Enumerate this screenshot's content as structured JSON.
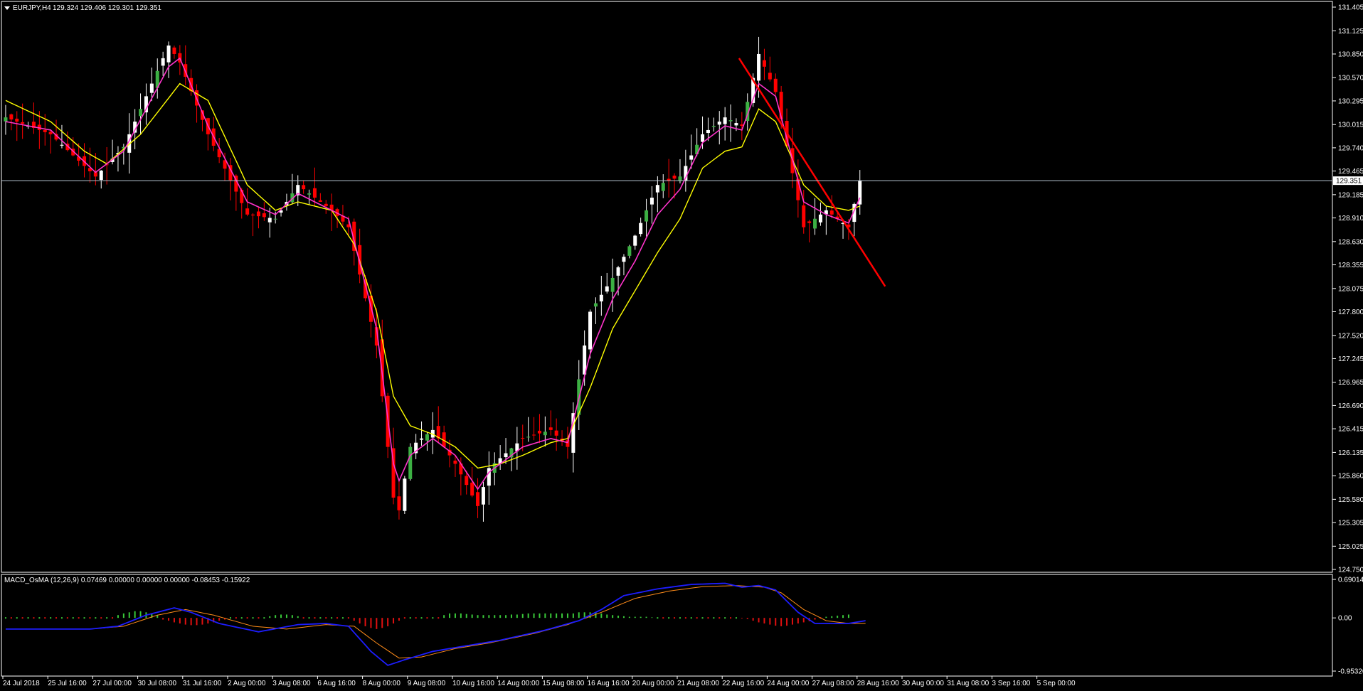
{
  "header": {
    "symbol": "EURJPY,H4",
    "ohlc": "129.324 129.406 129.301 129.351"
  },
  "indicator": {
    "title": "MACD_OsMA (12,26,9) 0.07469 0.00000 0.00000 0.00000 -0.08453 -0.15922"
  },
  "colors": {
    "background": "#000000",
    "frame": "#ffffff",
    "bull_candle": "#ffffff",
    "bull_candle_alt": "#3cb043",
    "bear_candle": "#ff0000",
    "ma_fast": "#ff33cc",
    "ma_slow": "#ffff00",
    "trendline": "#ff0000",
    "price_line": "#b7c3d0",
    "macd_main": "#1d1dff",
    "macd_signal": "#ff8c1a",
    "osma_pos": "#39c839",
    "osma_neg": "#e01010"
  },
  "chart_data": [
    {
      "type": "candlestick",
      "symbol": "EURJPY",
      "timeframe": "H4",
      "y_ticks": [
        "131.405",
        "131.125",
        "130.850",
        "130.570",
        "130.295",
        "130.015",
        "129.740",
        "129.465",
        "129.185",
        "128.910",
        "128.630",
        "128.355",
        "128.075",
        "127.800",
        "127.520",
        "127.245",
        "126.965",
        "126.690",
        "126.415",
        "126.135",
        "125.860",
        "125.580",
        "125.305",
        "125.025",
        "124.750"
      ],
      "ylim": [
        124.75,
        131.405
      ],
      "current_price": "129.351",
      "x_ticks": [
        "24 Jul 2018",
        "25 Jul 16:00",
        "27 Jul 00:00",
        "30 Jul 08:00",
        "31 Jul 16:00",
        "2 Aug 00:00",
        "3 Aug 08:00",
        "6 Aug 16:00",
        "8 Aug 00:00",
        "9 Aug 08:00",
        "10 Aug 16:00",
        "14 Aug 00:00",
        "15 Aug 08:00",
        "16 Aug 16:00",
        "20 Aug 00:00",
        "21 Aug 08:00",
        "22 Aug 16:00",
        "24 Aug 00:00",
        "27 Aug 08:00",
        "28 Aug 16:00",
        "30 Aug 00:00",
        "31 Aug 08:00",
        "3 Sep 16:00",
        "5 Sep 00:00"
      ],
      "price_path": [
        [
          0,
          130.1
        ],
        [
          8,
          129.9
        ],
        [
          16,
          129.4
        ],
        [
          21,
          129.75
        ],
        [
          29,
          130.95
        ],
        [
          31,
          130.75
        ],
        [
          36,
          129.9
        ],
        [
          43,
          128.95
        ],
        [
          48,
          128.9
        ],
        [
          52,
          129.3
        ],
        [
          58,
          129.0
        ],
        [
          61,
          128.8
        ],
        [
          66,
          127.4
        ],
        [
          69,
          125.6
        ],
        [
          70,
          125.45
        ],
        [
          72,
          126.2
        ],
        [
          76,
          126.4
        ],
        [
          80,
          126.0
        ],
        [
          84,
          125.5
        ],
        [
          86,
          125.95
        ],
        [
          92,
          126.3
        ],
        [
          97,
          126.4
        ],
        [
          100,
          126.2
        ],
        [
          104,
          127.8
        ],
        [
          108,
          128.2
        ],
        [
          112,
          128.7
        ],
        [
          116,
          129.3
        ],
        [
          120,
          129.4
        ],
        [
          124,
          129.9
        ],
        [
          128,
          130.1
        ],
        [
          131,
          130.0
        ],
        [
          134,
          130.85
        ],
        [
          137,
          130.4
        ],
        [
          142,
          128.8
        ],
        [
          146,
          129.0
        ],
        [
          150,
          128.8
        ],
        [
          152,
          129.35
        ]
      ],
      "ma_fast_path": [
        [
          0,
          130.05
        ],
        [
          8,
          129.95
        ],
        [
          16,
          129.45
        ],
        [
          21,
          129.7
        ],
        [
          29,
          130.7
        ],
        [
          31,
          130.8
        ],
        [
          36,
          130.0
        ],
        [
          43,
          129.1
        ],
        [
          48,
          128.95
        ],
        [
          52,
          129.2
        ],
        [
          58,
          129.0
        ],
        [
          61,
          128.9
        ],
        [
          66,
          127.6
        ],
        [
          69,
          126.0
        ],
        [
          70,
          125.8
        ],
        [
          72,
          126.1
        ],
        [
          76,
          126.3
        ],
        [
          80,
          126.1
        ],
        [
          84,
          125.7
        ],
        [
          86,
          125.9
        ],
        [
          92,
          126.2
        ],
        [
          97,
          126.3
        ],
        [
          100,
          126.25
        ],
        [
          104,
          127.3
        ],
        [
          108,
          127.95
        ],
        [
          112,
          128.4
        ],
        [
          116,
          128.95
        ],
        [
          120,
          129.25
        ],
        [
          124,
          129.8
        ],
        [
          128,
          130.0
        ],
        [
          131,
          129.95
        ],
        [
          134,
          130.5
        ],
        [
          137,
          130.35
        ],
        [
          142,
          129.1
        ],
        [
          146,
          128.95
        ],
        [
          150,
          128.85
        ],
        [
          152,
          129.15
        ]
      ],
      "ma_slow_path": [
        [
          0,
          130.3
        ],
        [
          8,
          130.05
        ],
        [
          14,
          129.7
        ],
        [
          18,
          129.55
        ],
        [
          24,
          129.9
        ],
        [
          31,
          130.5
        ],
        [
          36,
          130.3
        ],
        [
          43,
          129.3
        ],
        [
          48,
          129.0
        ],
        [
          52,
          129.1
        ],
        [
          58,
          129.0
        ],
        [
          62,
          128.6
        ],
        [
          66,
          127.8
        ],
        [
          69,
          126.8
        ],
        [
          72,
          126.45
        ],
        [
          76,
          126.35
        ],
        [
          80,
          126.2
        ],
        [
          84,
          125.95
        ],
        [
          88,
          126.0
        ],
        [
          92,
          126.1
        ],
        [
          97,
          126.25
        ],
        [
          100,
          126.3
        ],
        [
          104,
          126.9
        ],
        [
          108,
          127.6
        ],
        [
          112,
          128.05
        ],
        [
          116,
          128.5
        ],
        [
          120,
          128.9
        ],
        [
          124,
          129.5
        ],
        [
          128,
          129.7
        ],
        [
          131,
          129.75
        ],
        [
          134,
          130.2
        ],
        [
          137,
          130.05
        ],
        [
          142,
          129.3
        ],
        [
          146,
          129.05
        ],
        [
          150,
          129.0
        ],
        [
          152,
          129.05
        ]
      ],
      "trendline": [
        [
          131,
          130.8
        ],
        [
          157,
          128.1
        ]
      ]
    },
    {
      "type": "macd_osma",
      "y_ticks": [
        "0.69014",
        "0.00",
        "-0.95326"
      ],
      "ylim": [
        -0.95326,
        0.69014
      ],
      "macd_path": [
        [
          0,
          -0.2
        ],
        [
          15,
          -0.2
        ],
        [
          20,
          -0.15
        ],
        [
          25,
          0.05
        ],
        [
          30,
          0.18
        ],
        [
          33,
          0.1
        ],
        [
          38,
          -0.1
        ],
        [
          45,
          -0.25
        ],
        [
          52,
          -0.12
        ],
        [
          57,
          -0.1
        ],
        [
          61,
          -0.15
        ],
        [
          65,
          -0.6
        ],
        [
          68,
          -0.85
        ],
        [
          71,
          -0.75
        ],
        [
          76,
          -0.6
        ],
        [
          82,
          -0.5
        ],
        [
          88,
          -0.4
        ],
        [
          96,
          -0.22
        ],
        [
          102,
          -0.05
        ],
        [
          106,
          0.15
        ],
        [
          110,
          0.4
        ],
        [
          116,
          0.52
        ],
        [
          122,
          0.6
        ],
        [
          128,
          0.62
        ],
        [
          131,
          0.55
        ],
        [
          134,
          0.58
        ],
        [
          137,
          0.5
        ],
        [
          141,
          0.1
        ],
        [
          144,
          -0.1
        ],
        [
          150,
          -0.1
        ],
        [
          153,
          -0.05
        ]
      ],
      "signal_path": [
        [
          0,
          -0.2
        ],
        [
          15,
          -0.2
        ],
        [
          21,
          -0.15
        ],
        [
          27,
          0.05
        ],
        [
          32,
          0.15
        ],
        [
          37,
          0.05
        ],
        [
          44,
          -0.15
        ],
        [
          50,
          -0.2
        ],
        [
          57,
          -0.12
        ],
        [
          62,
          -0.15
        ],
        [
          66,
          -0.45
        ],
        [
          70,
          -0.72
        ],
        [
          74,
          -0.7
        ],
        [
          80,
          -0.55
        ],
        [
          86,
          -0.45
        ],
        [
          94,
          -0.28
        ],
        [
          100,
          -0.12
        ],
        [
          106,
          0.1
        ],
        [
          112,
          0.35
        ],
        [
          118,
          0.48
        ],
        [
          124,
          0.56
        ],
        [
          130,
          0.58
        ],
        [
          135,
          0.55
        ],
        [
          138,
          0.45
        ],
        [
          142,
          0.15
        ],
        [
          146,
          -0.05
        ],
        [
          150,
          -0.1
        ],
        [
          153,
          -0.1
        ]
      ],
      "osma_values": [
        0,
        0,
        0,
        0,
        0,
        0,
        0,
        0,
        0,
        0,
        0,
        0,
        0,
        0,
        0,
        0,
        0,
        0,
        0,
        0,
        0.05,
        0.08,
        0.1,
        0.12,
        0.12,
        0.1,
        0.08,
        0.05,
        -0.03,
        -0.05,
        -0.08,
        -0.1,
        -0.12,
        -0.13,
        -0.13,
        -0.12,
        -0.1,
        -0.08,
        -0.05,
        -0.03,
        0,
        0,
        0,
        0,
        0,
        0,
        0,
        0.03,
        0.05,
        0.06,
        0.06,
        0.05,
        0.03,
        0,
        0,
        0,
        0,
        0,
        0,
        0,
        0,
        0,
        -0.05,
        -0.1,
        -0.15,
        -0.18,
        -0.2,
        -0.18,
        -0.15,
        -0.1,
        -0.05,
        0,
        0,
        0,
        0,
        0,
        0,
        0,
        0.05,
        0.08,
        0.08,
        0.08,
        0.07,
        0.06,
        0.05,
        0.05,
        0.05,
        0.05,
        0.05,
        0.05,
        0.06,
        0.06,
        0.07,
        0.08,
        0.08,
        0.08,
        0.08,
        0.08,
        0.08,
        0.08,
        0.08,
        0.08,
        0.1,
        0.1,
        0.1,
        0.1,
        0.08,
        0.06,
        0.05,
        0.04,
        0.03,
        0.02,
        0.02,
        0.02,
        0.02,
        0.01,
        0,
        0,
        0,
        0,
        0,
        0,
        0,
        0,
        0,
        0,
        0,
        0,
        0,
        0,
        0,
        -0.01,
        -0.02,
        -0.05,
        -0.08,
        -0.1,
        -0.12,
        -0.14,
        -0.15,
        -0.14,
        -0.12,
        -0.1,
        -0.08,
        -0.06,
        -0.03,
        0,
        0.02,
        0.03,
        0.04,
        0.05,
        0.06
      ]
    }
  ]
}
